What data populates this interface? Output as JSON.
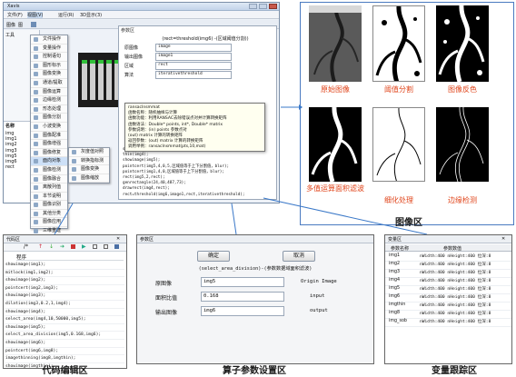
{
  "app_window": {
    "title": "Xavis",
    "menu": [
      "文件(F)",
      "视图(V)",
      "运行(R)",
      "3D显示(3)"
    ],
    "tool_labels": [
      "图像",
      "图"
    ],
    "toolbox_header": "工具",
    "dropdown_items": [
      "文件操作",
      "变量操作",
      "控制语句",
      "图形标示",
      "图像变换",
      "通道/提取",
      "图像运算",
      "边缘检测",
      "形态处理",
      "图像分割",
      "小波变换",
      "图像配准",
      "图像增强",
      "图像修复",
      "面向对象",
      "图像检测",
      "图像融合",
      "离散列值",
      "本节说明",
      "图像识别",
      "其他分类",
      "图像应用",
      "三维重建",
      "三维显示"
    ],
    "submenu_items": [
      "灰度值对照",
      "转换指标测",
      "图像变换",
      "图像缩放"
    ],
    "varlist_header": "名称",
    "varlist_names": [
      "img",
      "img1",
      "img2",
      "img3",
      "img5",
      "img6",
      "rect"
    ],
    "varlist_values": [
      "u8(IMAGE_)",
      "8bit_img",
      "1291",
      "17 3913",
      "585517"
    ],
    "code_small": [
      "w(img6)",
      "ie(img6)"
    ]
  },
  "tooltip": {
    "lines": [
      "ransacInsmmat",
      "函数名称：随机抽样与计算",
      "函数功能：利用RANSAC去除错误点对并计算转换矩阵",
      "函数语法：Double* points, int*, Double* matrix",
      "参数说明：(in) points 参数点对",
      "  (out) matrix 计算的转换矩阵",
      "返回参数：(out) matrix 计算的转换矩阵",
      "调用举例：ransacInsmmat(pts,10,mat)"
    ]
  },
  "param_small": {
    "header": "参数区",
    "func_name": "(rect=threshold(img6) -(区域阈值分割))",
    "rows": [
      {
        "label": "原图像",
        "value": "image"
      },
      {
        "label": "输出图像",
        "value": "image1"
      },
      {
        "label": "区域",
        "value": "rect"
      },
      {
        "label": "算法",
        "value": "iterativethreshold"
      }
    ],
    "code_lines": [
      "showimage(img4);",
      "thin(img4);",
      "showimage(img5);",
      "pointcert(img5,4,0,5,区域值等于上下分割值，blur);",
      "pointcert(img1,4,0,区域值等于上下分割值，blur);",
      "rect(img5,2,rect);",
      "genrectangle(24,40,487,73);",
      "drawrect(img4,rect);",
      "rect=threshold(img6,image1,rect,iterativethreshold);"
    ]
  },
  "image_area": {
    "caption": "图像区",
    "thumb_labels": [
      "原始图像",
      "阈值分割",
      "图像反色",
      "多值运算面积滤波",
      "细化处理",
      "边缘检测"
    ]
  },
  "code_panel": {
    "title": "代码区",
    "header": "程序",
    "lines": [
      "showimage(img1);",
      "mitlock(img1,img2);",
      "showimage(img2);",
      "pointcert(img2,img3);",
      "showimage(img3);",
      "dilation(img3,0.2,1,img4);",
      "showimage(img4);",
      "select_area(img4,10,50000,img5);",
      "showimage(img5);",
      "select_area_division(img5,0.168,img6);",
      "showimage(img6);",
      "pointcert(img6,img8);",
      "imagethinning(img8,imgthin);",
      "showimage(imgthin);",
      "sobel_edge(imgthin,img_sobel);"
    ],
    "caption": "代码编辑区"
  },
  "param_panel": {
    "title": "参数区",
    "confirm": "确定",
    "cancel": "取消",
    "func_line": "(select_area_division)-(参数数据域面积滤波)",
    "fields": [
      {
        "label": "原图像",
        "value": "img5",
        "desc": "Origin Image"
      },
      {
        "label": "面积比值",
        "value": "0.168",
        "desc": "input"
      },
      {
        "label": "输出图像",
        "value": "img6",
        "desc": "output"
      }
    ],
    "caption": "算子参数设置区"
  },
  "var_panel": {
    "title": "变量区",
    "headers": [
      "参数名称",
      "参数数值"
    ],
    "rows": [
      {
        "name": "img1",
        "value": "nWidth:400 nHeight:400 位深:8"
      },
      {
        "name": "img2",
        "value": "nWidth:400 nHeight:400 位深:8"
      },
      {
        "name": "img3",
        "value": "nWidth:400 nHeight:400 位深:8"
      },
      {
        "name": "img4",
        "value": "nWidth:400 nHeight:400 位深:8"
      },
      {
        "name": "img5",
        "value": "nWidth:400 nHeight:400 位深:8"
      },
      {
        "name": "img6",
        "value": "nWidth:400 nHeight:400 位深:8"
      },
      {
        "name": "imgthin",
        "value": "nWidth:400 nHeight:400 位深:8"
      },
      {
        "name": "img8",
        "value": "nWidth:400 nHeight:400 位深:8"
      },
      {
        "name": "img_sob",
        "value": "nWidth:400 nHeight:400 位深:8"
      }
    ],
    "caption": "变量跟踪区"
  },
  "colors": {
    "accent": "#1f6fc7",
    "window_border": "#7b8fa8",
    "callout_line": "#3a78c8"
  }
}
